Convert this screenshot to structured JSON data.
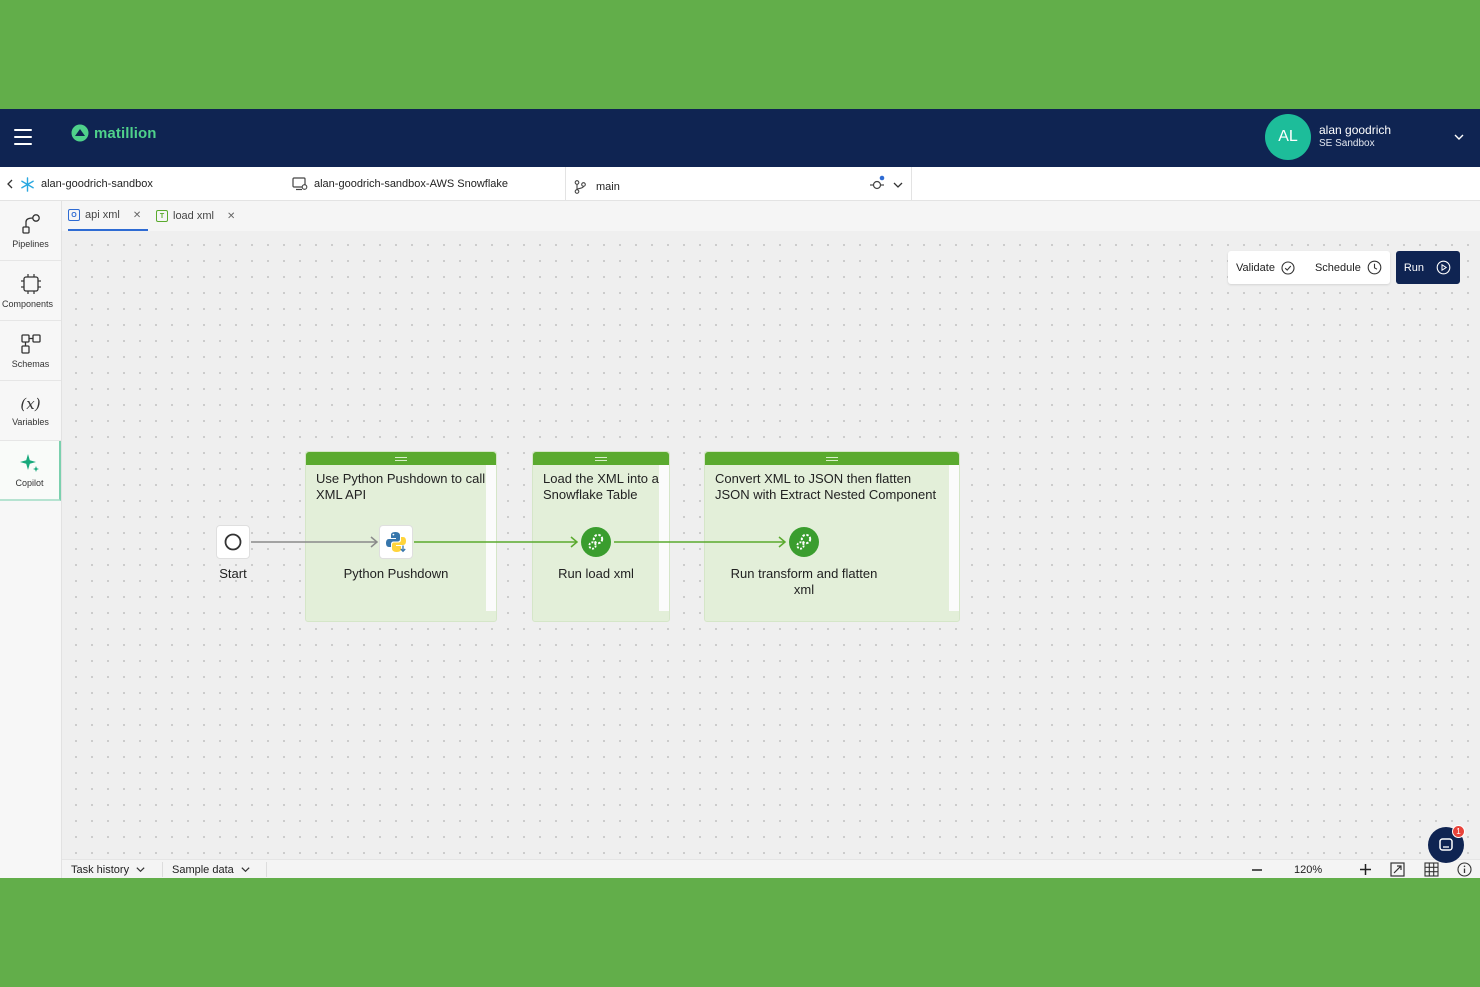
{
  "header": {
    "logo_text": "matillion",
    "user": {
      "initials": "AL",
      "name": "alan goodrich",
      "env": "SE Sandbox"
    }
  },
  "context": {
    "project": "alan-goodrich-sandbox",
    "environment": "alan-goodrich-sandbox-AWS Snowflake",
    "branch": "main"
  },
  "tabs": [
    {
      "label": "api xml",
      "badge": "O",
      "badge_color": "#2e6bd3"
    },
    {
      "label": "load xml",
      "badge": "T",
      "badge_color": "#5aaa2e"
    }
  ],
  "sidebar": {
    "items": [
      {
        "label": "Pipelines"
      },
      {
        "label": "Components"
      },
      {
        "label": "Schemas"
      },
      {
        "label": "Variables"
      },
      {
        "label": "Copilot"
      }
    ]
  },
  "toolbar": {
    "validate": "Validate",
    "schedule": "Schedule",
    "run": "Run"
  },
  "canvas": {
    "notes": [
      {
        "text": "Use Python Pushdown to call XML API"
      },
      {
        "text": "Load the XML into a Snowflake Table"
      },
      {
        "text": "Convert XML to JSON then flatten JSON with Extract Nested Component"
      }
    ],
    "nodes": [
      {
        "label": "Start"
      },
      {
        "label": "Python Pushdown"
      },
      {
        "label": "Run load xml"
      },
      {
        "label": "Run transform and flatten xml"
      }
    ]
  },
  "bottom": {
    "task_history": "Task history",
    "sample_data": "Sample data",
    "zoom": "120%"
  },
  "chat": {
    "badge": "1"
  },
  "colors": {
    "topbar": "#0f2452",
    "accent_green": "#5aaa2e",
    "note_bg": "#e3efd9",
    "avatar": "#1dbd9a"
  }
}
